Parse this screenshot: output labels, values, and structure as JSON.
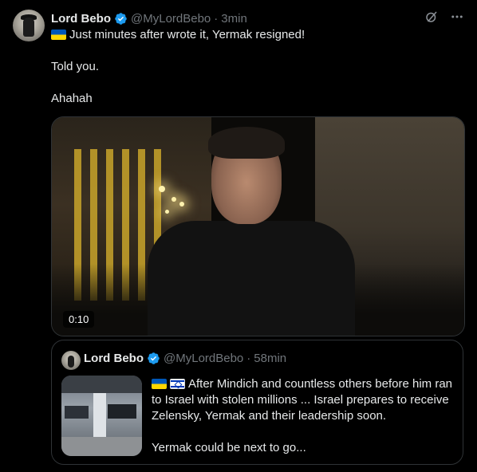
{
  "tweet": {
    "author_name": "Lord Bebo",
    "handle": "@MyLordBebo",
    "separator": "·",
    "time": "3min",
    "lines": [
      "Just minutes after wrote it, Yermak resigned!",
      "Told you.",
      "Ahahah"
    ],
    "flag_icon": "ukraine-flag-icon"
  },
  "video": {
    "duration": "0:10"
  },
  "quote": {
    "author_name": "Lord Bebo",
    "handle": "@MyLordBebo",
    "separator": "·",
    "time": "58min",
    "paragraph_1": "After Mindich and countless others before him ran to Israel with stolen millions ... Israel prepares to receive Zelensky, Yermak and their leadership soon.",
    "paragraph_2": "Yermak could be next to go..."
  },
  "colors": {
    "background": "#000000",
    "text": "#e7e9ea",
    "muted": "#71767b",
    "border": "#2f3336",
    "verified": "#1d9bf0"
  },
  "icons": [
    "verified-badge-icon",
    "grok-icon",
    "more-icon",
    "ukraine-flag-icon",
    "israel-flag-icon"
  ]
}
